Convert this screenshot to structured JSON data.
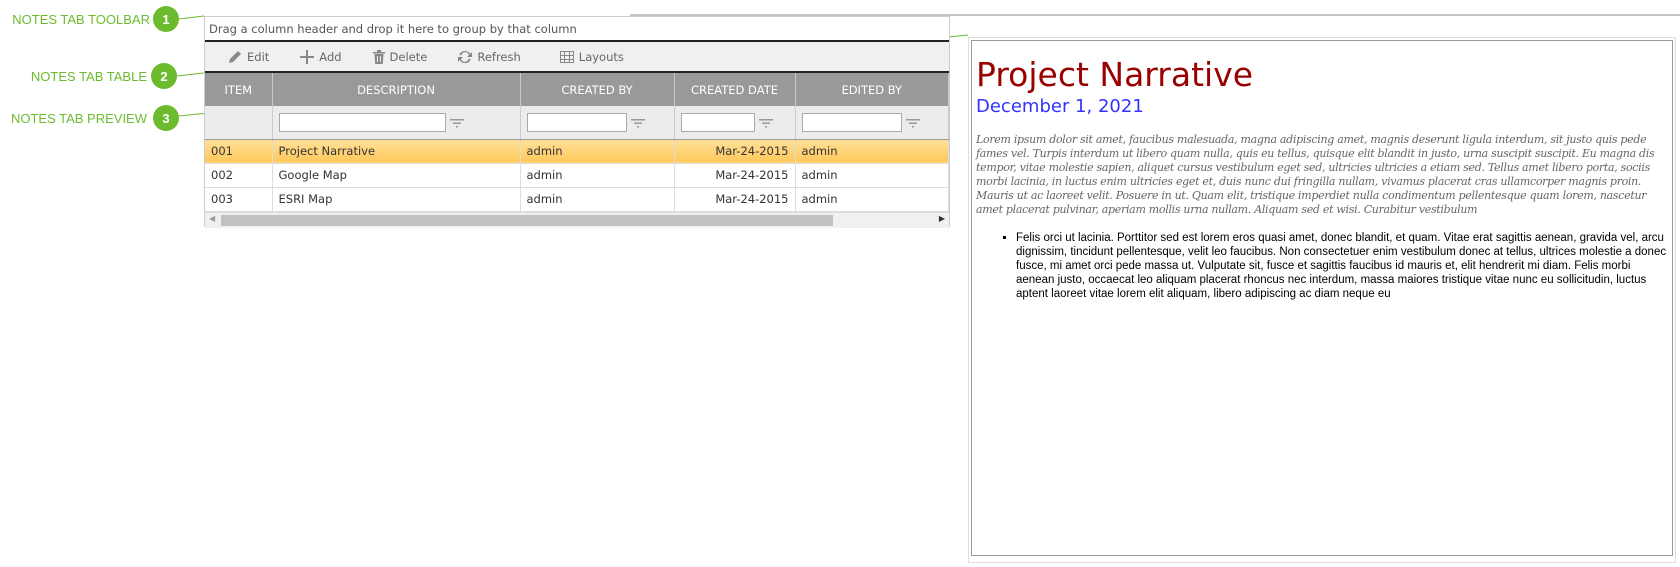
{
  "callouts": [
    {
      "number": "1",
      "label": "NOTES TAB TOOLBAR"
    },
    {
      "number": "2",
      "label": "NOTES TAB TABLE"
    },
    {
      "number": "3",
      "label": "NOTES TAB PREVIEW"
    }
  ],
  "grid": {
    "group_hint": "Drag a column header and drop it here to group by that column",
    "toolbar": {
      "edit": "Edit",
      "add": "Add",
      "delete": "Delete",
      "refresh": "Refresh",
      "layouts": "Layouts"
    },
    "columns": [
      "ITEM",
      "DESCRIPTION",
      "CREATED BY",
      "CREATED DATE",
      "EDITED BY"
    ],
    "rows": [
      {
        "item": "001",
        "description": "Project Narrative",
        "created_by": "admin",
        "created_date": "Mar-24-2015",
        "edited_by": "admin",
        "selected": true
      },
      {
        "item": "002",
        "description": "Google Map",
        "created_by": "admin",
        "created_date": "Mar-24-2015",
        "edited_by": "admin"
      },
      {
        "item": "003",
        "description": "ESRI Map",
        "created_by": "admin",
        "created_date": "Mar-24-2015",
        "edited_by": "admin"
      }
    ]
  },
  "preview": {
    "title": "Project Narrative",
    "date": "December 1, 2021",
    "lorem": "Lorem ipsum dolor sit amet, faucibus malesuada, magna adipiscing amet, magnis deserunt ligula interdum, sit justo quis pede fames vel. Turpis interdum ut libero quam nulla, quis eu tellus, quisque elit blandit in justo, urna suscipit suscipit. Eu magna dis tempor, vitae molestie sapien, aliquet cursus vestibulum eget sed, ultricies ultricies a etiam sed. Tellus amet libero porta, sociis morbi lacinia, in luctus enim ultricies eget et, duis nunc dui fringilla nullam, vivamus placerat cras ullamcorper magnis proin. Mauris ut ac laoreet velit. Posuere in ut. Quam elit, tristique imperdiet nulla condimentum pellentesque quam lorem, nascetur amet placerat pulvinar, aperiam mollis urna nullam. Aliquam sed et wisi. Curabitur vestibulum",
    "bullet": "Felis orci ut lacinia. Porttitor sed est lorem eros quasi amet, donec blandit, et quam. Vitae erat sagittis aenean, gravida vel, arcu dignissim, tincidunt pellentesque, velit leo faucibus. Non consectetuer enim vestibulum donec at tellus, ultrices molestie a donec fusce, mi amet orci pede massa ut. Vulputate sit, fusce et sagittis faucibus id mauris et, elit hendrerit mi diam. Felis morbi aenean justo, occaecat leo aliquam placerat rhoncus nec interdum, massa maiores tristique vitae nunc eu sollicitudin, luctus aptent laoreet vitae lorem elit aliquam, libero adipiscing ac diam neque eu"
  },
  "colors": {
    "callout": "#6cbb2e",
    "title": "#990000",
    "date": "#3333ff",
    "selected_row": "#ffc85a",
    "header": "#999999"
  }
}
